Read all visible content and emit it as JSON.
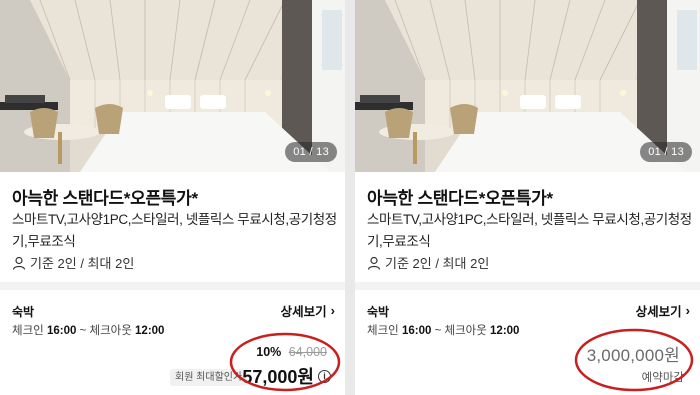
{
  "cards": [
    {
      "photo_counter": "01 / 13",
      "title": "아늑한 스탠다드*오픈특가*",
      "amenities": "스마트TV,고사양1PC,스타일러, 넷플릭스 무료시청,공기청정기,무료조식",
      "capacity": "기준 2인 / 최대 2인",
      "stay_label": "숙박",
      "detail_label": "상세보기",
      "checkin_label": "체크인",
      "checkin_time": "16:00",
      "separator": "~",
      "checkout_label": "체크아웃",
      "checkout_time": "12:00",
      "discount_rate": "10%",
      "original_price": "64,000",
      "member_badge": "회원 최대할인가",
      "price": "57,000원",
      "info_icon": "info-icon"
    },
    {
      "photo_counter": "01 / 13",
      "title": "아늑한 스탠다드*오픈특가*",
      "amenities": "스마트TV,고사양1PC,스타일러, 넷플릭스 무료시청,공기청정기,무료조식",
      "capacity": "기준 2인 / 최대 2인",
      "stay_label": "숙박",
      "detail_label": "상세보기",
      "checkin_label": "체크인",
      "checkin_time": "16:00",
      "separator": "~",
      "checkout_label": "체크아웃",
      "checkout_time": "12:00",
      "price": "3,000,000원",
      "status": "예약마감"
    }
  ],
  "colors": {
    "annotation_circle": "#c8201e",
    "card_bg": "#ffffff",
    "divider": "#f3f3f3"
  }
}
